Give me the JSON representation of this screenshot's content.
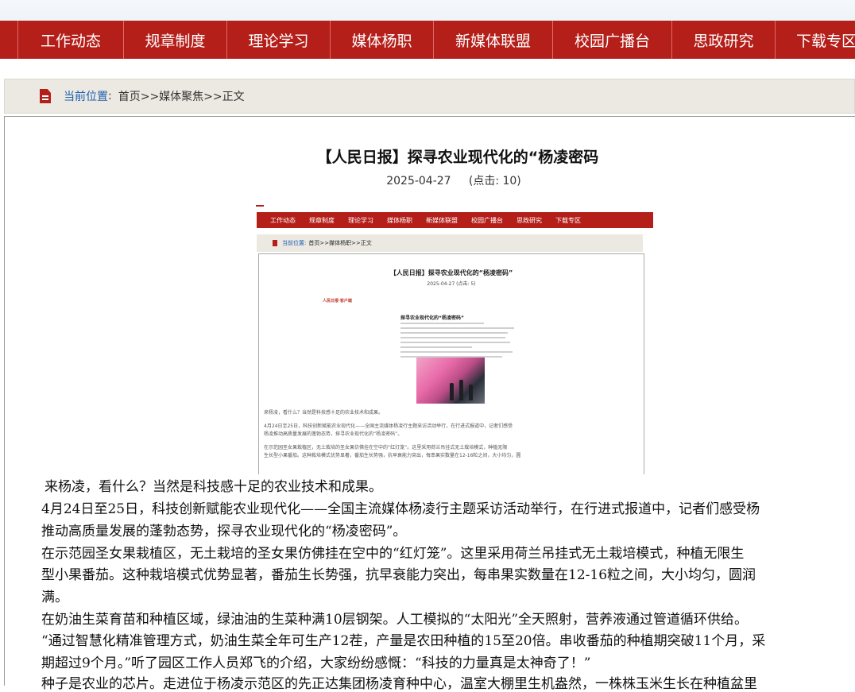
{
  "nav": {
    "items": [
      "工作动态",
      "规章制度",
      "理论学习",
      "媒体杨职",
      "新媒体联盟",
      "校园广播台",
      "思政研究",
      "下载专区"
    ]
  },
  "breadcrumb": {
    "label": "当前位置",
    "separator": ":",
    "path": "首页>>媒体聚焦>>正文"
  },
  "article": {
    "title": "【人民日报】探寻农业现代化的“杨凌密码",
    "date": "2025-04-27",
    "clicks": "(点击: 10)",
    "paragraphs": [
      "来杨凌，看什么？当然是科技感十足的农业技术和成果。",
      "4月24日至25日，科技创新赋能农业现代化——全国主流媒体杨凌行主题采访活动举行，在行进式报道中，记者们感受杨",
      "推动高质量发展的蓬勃态势，探寻农业现代化的“杨凌密码”。",
      "在示范园圣女果栽植区，无土栽培的圣女果仿佛挂在空中的“红灯笼”。这里采用荷兰吊挂式无土栽培模式，种植无限生",
      "型小果番茄。这种栽培模式优势显著，番茄生长势强，抗早衰能力突出，每串果实数量在12-16粒之间，大小均匀，圆润",
      "满。",
      "在奶油生菜育苗和种植区域，绿油油的生菜种满10层钢架。人工模拟的“太阳光”全天照射，营养液通过管道循环供给。",
      "“通过智慧化精准管理方式，奶油生菜全年可生产12茬，产量是农田种植的15至20倍。串收番茄的种植期突破11个月，采",
      "期超过9个月。”听了园区工作人员郑飞的介绍，大家纷纷感慨：“科技的力量真是太神奇了！”",
      "种子是农业的芯片。走进位于杨凌示范区的先正达集团杨凌育种中心，温室大棚里生机盎然，一株株玉米生长在种植盆里"
    ]
  },
  "embedded_screenshot": {
    "nav_items": [
      "工作动态",
      "规章制度",
      "理论学习",
      "媒体杨职",
      "新媒体联盟",
      "校园广播台",
      "思政研究",
      "下载专区"
    ],
    "crumb_label": "当前位置:",
    "crumb_path": "首页>>媒体杨职>>正文",
    "title": "【人民日报】探寻农业现代化的“杨凌密码”",
    "meta": "2025-04-27    (点击:  5)",
    "inner_brand": "人民日报·客户端",
    "inner_subtitle": "探寻农业现代化的“杨凌密码”",
    "text_lines": [
      "来杨凌，看什么？当然是科技感十足的农业技术和成果。",
      "4月24日至25日，科技创新赋能农业现代化——全国主流媒体杨凌行主题采访活动举行，在行进式报道中，记者们感受",
      "杨凌推动高质量发展的蓬勃态势，探寻农业现代化的“杨凌密码”。",
      "在示范园圣女果栽植区，无土栽培的圣女果仿佛挂在空中的“红灯笼”。这里采用荷兰吊挂式无土栽培模式，种植无限",
      "生长型小果番茄。这种栽培模式优势显著，番茄生长势强，抗早衰能力突出，每串果实数量在12-16粒之间，大小均匀，圆"
    ]
  },
  "colors": {
    "nav_bg": "#b41f1a",
    "crumb_bg": "#ece9e2",
    "link_blue": "#1f5fb0"
  }
}
